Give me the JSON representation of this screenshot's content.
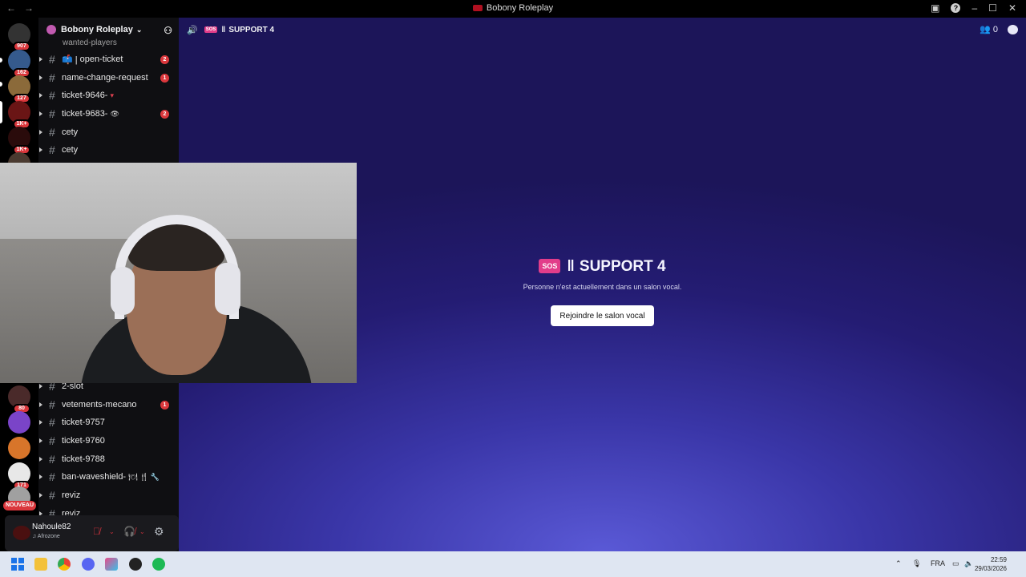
{
  "window": {
    "title": "Bobony Roleplay"
  },
  "rail": {
    "servers": [
      {
        "badge": "907",
        "color": "#3b3b44"
      },
      {
        "badge": "162",
        "color": "#355a8c"
      },
      {
        "badge": "127",
        "color": "#8b6a3a"
      },
      {
        "badge": "1K+",
        "color": "#6a1515"
      },
      {
        "badge": "1K+",
        "color": "#2a0b0b"
      },
      {
        "badge": "80",
        "color": "#4a2a2a"
      },
      {
        "badge": "",
        "color": "#7a44c8"
      },
      {
        "badge": "",
        "color": "#d8752a"
      },
      {
        "badge": "171",
        "color": "#e8e8e8"
      },
      {
        "badge": "NOUVEAU",
        "color": "#a0a0a0"
      }
    ]
  },
  "sidebar": {
    "server_name": "Bobony Roleplay",
    "cut_channel": "wanted-players",
    "channels_top": [
      {
        "name": "open-ticket",
        "prefix": "📫 |",
        "suffix": "",
        "unread": "2"
      },
      {
        "name": "name-change-request",
        "prefix": "",
        "suffix": "",
        "unread": "1"
      },
      {
        "name": "ticket-9646-",
        "prefix": "",
        "suffix": "▾",
        "unread": ""
      },
      {
        "name": "ticket-9683-",
        "prefix": "",
        "suffix": "👁",
        "unread": "2"
      },
      {
        "name": "cety",
        "prefix": "",
        "suffix": "",
        "unread": ""
      },
      {
        "name": "cety",
        "prefix": "",
        "suffix": "",
        "unread": ""
      }
    ],
    "channels_bottom": [
      {
        "name": "2-slot",
        "suffix": "",
        "unread": ""
      },
      {
        "name": "vetements-mecano",
        "suffix": "",
        "unread": "1"
      },
      {
        "name": "ticket-9757",
        "suffix": "",
        "unread": ""
      },
      {
        "name": "ticket-9760",
        "suffix": "",
        "unread": ""
      },
      {
        "name": "ticket-9788",
        "suffix": "",
        "unread": ""
      },
      {
        "name": "ban-waveshield-",
        "suffix": "🍽 🍴 🔧",
        "unread": ""
      },
      {
        "name": "reviz",
        "suffix": "",
        "unread": ""
      },
      {
        "name": "reviz",
        "suffix": "",
        "unread": ""
      }
    ]
  },
  "user": {
    "name": "Nahoule82",
    "status": "♫ Afrozone"
  },
  "main": {
    "header_tag": "SOS",
    "header_title": "SUPPORT 4",
    "member_count": "0",
    "center_title": "SUPPORT 4",
    "center_sub": "Personne n'est actuellement dans un salon vocal.",
    "join_label": "Rejoindre le salon vocal"
  },
  "taskbar": {
    "lang": "FRA",
    "time": "22:59",
    "date": "29/03/2026"
  }
}
